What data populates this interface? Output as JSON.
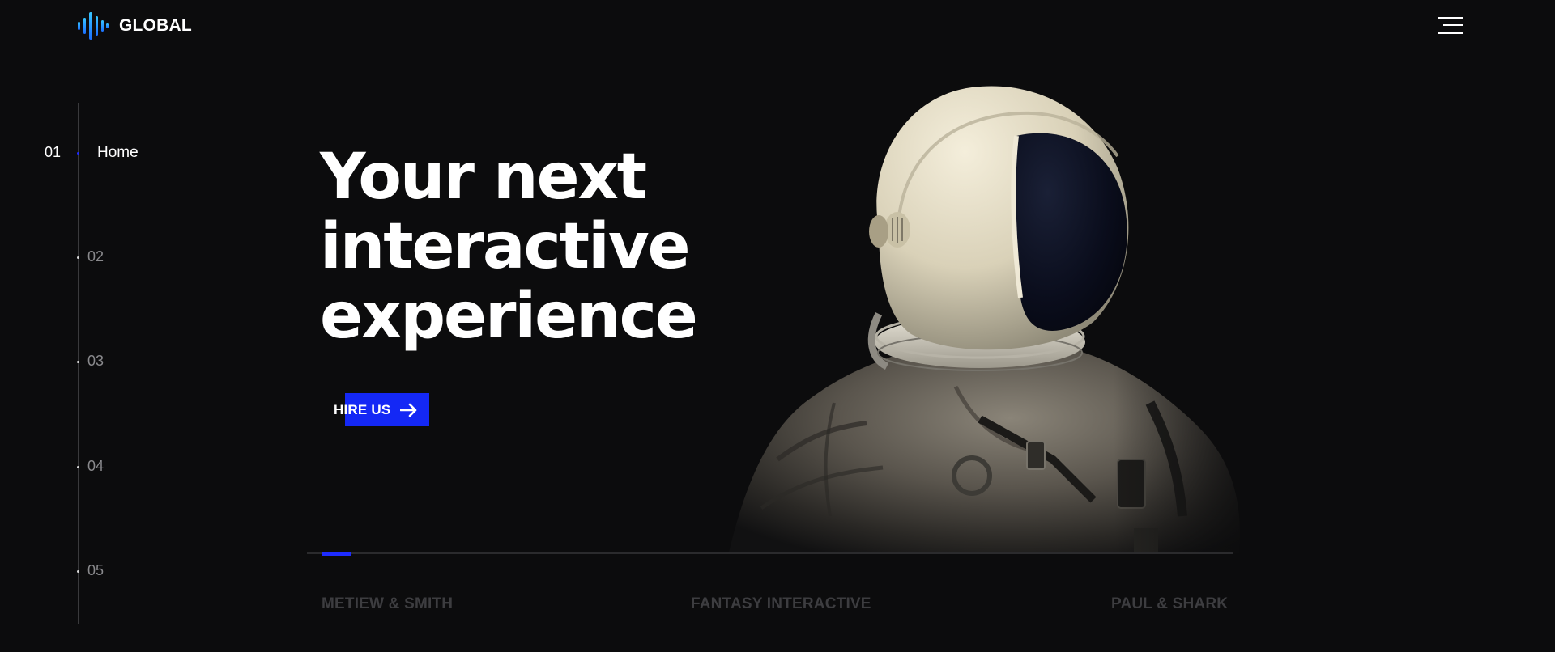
{
  "brand": {
    "name": "GLOBAL",
    "logo_icon": "soundwave-icon",
    "logo_gradient": [
      "#2fb8ff",
      "#1d7bff"
    ]
  },
  "header": {
    "menu_icon": "hamburger-menu-icon"
  },
  "side_nav": {
    "items": [
      {
        "number": "01",
        "label": "Home",
        "active": true
      },
      {
        "number": "02",
        "label": "",
        "active": false
      },
      {
        "number": "03",
        "label": "",
        "active": false
      },
      {
        "number": "04",
        "label": "",
        "active": false
      },
      {
        "number": "05",
        "label": "",
        "active": false
      }
    ]
  },
  "hero": {
    "title_lines": [
      "Your next",
      "interactive",
      "experience"
    ],
    "cta_label": "HIRE US",
    "cta_icon": "arrow-right-icon",
    "image": "astronaut-image"
  },
  "slider": {
    "progress": 0.032
  },
  "clients": [
    "METIEW & SMITH",
    "FANTASY INTERACTIVE",
    "PAUL & SHARK"
  ],
  "colors": {
    "background": "#0c0c0d",
    "accent": "#1428f5",
    "muted_text": "#3d3d40"
  }
}
